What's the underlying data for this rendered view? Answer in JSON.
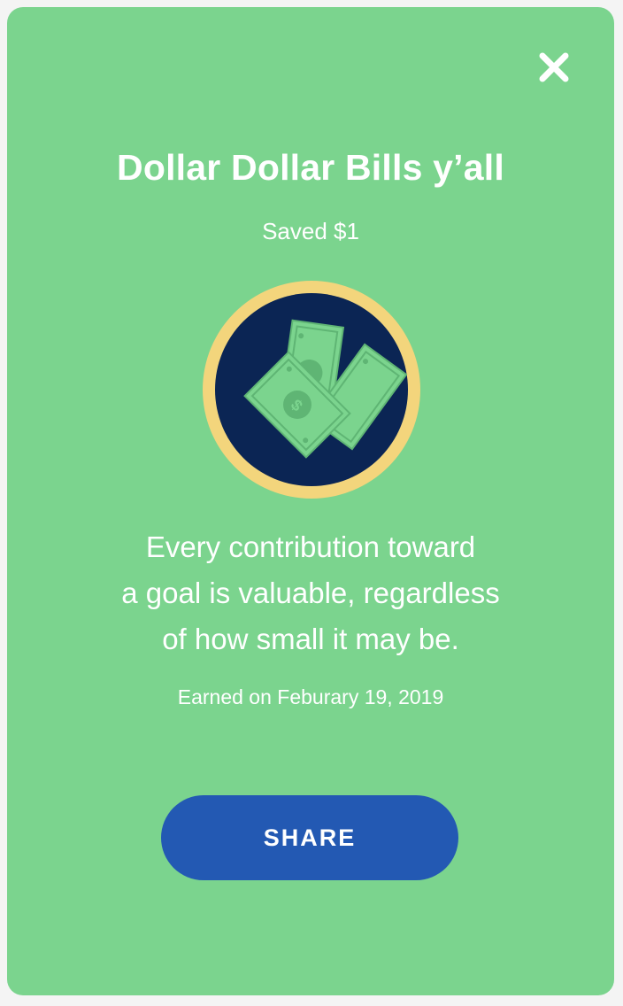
{
  "modal": {
    "title": "Dollar Dollar Bills y’all",
    "subtitle": "Saved $1",
    "message_lines": [
      "Every contribution toward",
      "a goal is valuable, regardless",
      "of how small it may be."
    ],
    "earned": "Earned on Feburary 19, 2019",
    "share_label": "SHARE"
  },
  "icons": {
    "close": "close-icon",
    "badge": "dollar-bills-badge-icon"
  },
  "colors": {
    "card_background": "#7bd48e",
    "badge_ring": "#f3d57c",
    "badge_fill": "#0b2554",
    "bill_green": "#7bd48e",
    "button": "#2359b3",
    "text": "#ffffff"
  }
}
